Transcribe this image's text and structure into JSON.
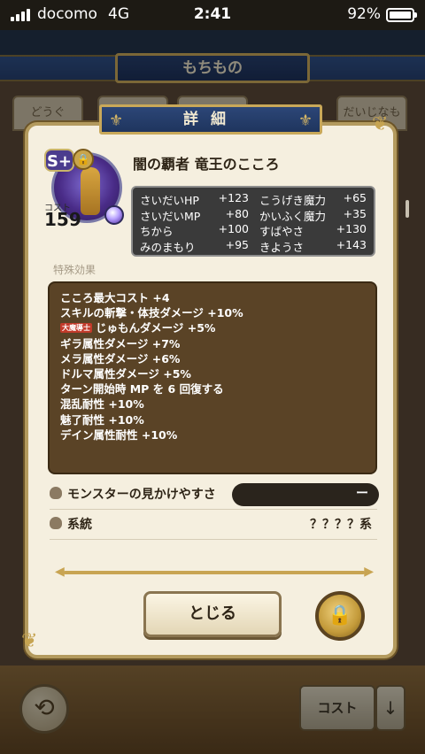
{
  "status_bar": {
    "carrier": "docomo",
    "network": "4G",
    "time": "2:41",
    "battery": "92%"
  },
  "background": {
    "title": "もちもの",
    "tabs": [
      "どうぐ",
      "",
      "",
      "だいじなもの"
    ],
    "cost_button": "コスト",
    "sort_icon": "arrow-down-icon",
    "back_icon": "back-arrow-icon"
  },
  "modal": {
    "header": "詳細",
    "monster": {
      "rank": "S+",
      "cost_label": "コスト",
      "cost_value": "159",
      "name": "闇の覇者 竜王のこころ"
    },
    "stats": [
      {
        "k1": "さいだいHP",
        "v1": "+123",
        "k2": "こうげき魔力",
        "v2": "+65"
      },
      {
        "k1": "さいだいMP",
        "v1": "+80",
        "k2": "かいふく魔力",
        "v2": "+35"
      },
      {
        "k1": "ちから",
        "v1": "+100",
        "k2": "すばやさ",
        "v2": "+130"
      },
      {
        "k1": "みのまもり",
        "v1": "+95",
        "k2": "きようさ",
        "v2": "+143"
      }
    ],
    "special_label": "特殊効果",
    "effects": [
      {
        "tag": "",
        "text": "こころ最大コスト +4"
      },
      {
        "tag": "",
        "text": "スキルの斬撃・体技ダメージ +10%"
      },
      {
        "tag": "大魔導士",
        "text": "じゅもんダメージ +5%"
      },
      {
        "tag": "",
        "text": "ギラ属性ダメージ +7%"
      },
      {
        "tag": "",
        "text": "メラ属性ダメージ +6%"
      },
      {
        "tag": "",
        "text": "ドルマ属性ダメージ +5%"
      },
      {
        "tag": "",
        "text": "ターン開始時 MP を 6 回復する"
      },
      {
        "tag": "",
        "text": "混乱耐性 +10%"
      },
      {
        "tag": "",
        "text": "魅了耐性 +10%"
      },
      {
        "tag": "",
        "text": "デイン属性耐性 +10%"
      }
    ],
    "visibility_label": "モンスターの見かけやすさ",
    "visibility_value": "ー",
    "lineage_label": "系統",
    "lineage_value": "？？？？系",
    "close_button": "とじる",
    "lock_icon": "lock-icon"
  }
}
